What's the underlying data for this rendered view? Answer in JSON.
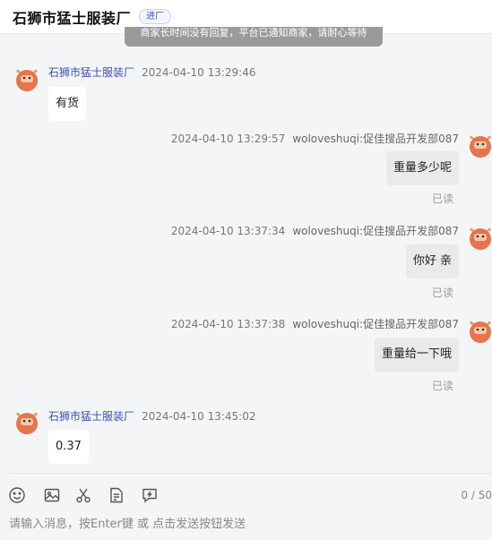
{
  "header": {
    "title": "石狮市猛士服装厂",
    "badge": "进厂"
  },
  "notice": "商家长时间没有回复，平台已通知商家，请耐心等待",
  "messages": [
    {
      "side": "in",
      "sender": "石狮市猛士服装厂",
      "time": "2024-04-10 13:29:46",
      "text": "有货"
    },
    {
      "side": "out",
      "sender": "woloveshuqi:促佳搜品开发部087",
      "time": "2024-04-10 13:29:57",
      "text": "重量多少呢",
      "status": "已读"
    },
    {
      "side": "out",
      "sender": "woloveshuqi:促佳搜品开发部087",
      "time": "2024-04-10 13:37:34",
      "text": "你好 亲",
      "status": "已读"
    },
    {
      "side": "out",
      "sender": "woloveshuqi:促佳搜品开发部087",
      "time": "2024-04-10 13:37:38",
      "text": "重量给一下哦",
      "status": "已读"
    },
    {
      "side": "in",
      "sender": "石狮市猛士服装厂",
      "time": "2024-04-10 13:45:02",
      "text": "0.37"
    }
  ],
  "toolbar": {
    "icons": [
      "emoji-icon",
      "image-icon",
      "scissors-icon",
      "document-icon",
      "quick-reply-icon"
    ],
    "counter": "0 / 50"
  },
  "input": {
    "placeholder": "请输入消息，按Enter键 或 点击发送按钮发送",
    "value": ""
  },
  "colors": {
    "shop_name": "#3a4fb0",
    "avatar": "#e8744c",
    "bubble_out": "#e9eaec"
  }
}
